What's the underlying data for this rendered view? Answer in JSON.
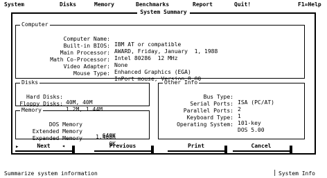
{
  "menu": {
    "system": "System",
    "disks": "Disks",
    "memory": "Memory",
    "benchmarks": "Benchmarks",
    "report": "Report",
    "quit": "Quit!",
    "help": "F1=Help"
  },
  "dialog": {
    "title": "System Summary"
  },
  "computer": {
    "title": "Computer",
    "rows": [
      {
        "label": "Computer Name:",
        "value": "IBM AT or compatible"
      },
      {
        "label": "Built-in BIOS:",
        "value": "AWARD, Friday, January  1, 1988"
      },
      {
        "label": "Main Processor:",
        "value": "Intel 80286  12 MHz"
      },
      {
        "label": "Math Co-Processor:",
        "value": "None"
      },
      {
        "label": "Video Adapter:",
        "value": "Enhanced Graphics (EGA)"
      },
      {
        "label": "Mouse Type:",
        "value": "InPort mouse, Version 8.00"
      }
    ]
  },
  "disks": {
    "title": "Disks",
    "rows": [
      {
        "label": "Hard Disks:",
        "value": "40M, 40M"
      },
      {
        "label": "Floppy Disks:",
        "value": "1.2M, 1.44M"
      }
    ]
  },
  "memory": {
    "title": "Memory",
    "rows": [
      {
        "label": "DOS Memory",
        "value": "640K"
      },
      {
        "label": "Extended Memory",
        "value": "1,408K"
      },
      {
        "label": "Expanded Memory",
        "value": "0K"
      }
    ]
  },
  "other": {
    "title": "Other Info",
    "rows": [
      {
        "label": "Bus Type:",
        "value": "ISA (PC/AT)"
      },
      {
        "label": "Serial Ports:",
        "value": "2"
      },
      {
        "label": "Parallel Ports:",
        "value": "1"
      },
      {
        "label": "Keyboard Type:",
        "value": "101-key"
      },
      {
        "label": "Operating System:",
        "value": "DOS 5.00"
      }
    ]
  },
  "buttons": {
    "next": "Next",
    "previous": "Previous",
    "print": "Print",
    "cancel": "Cancel"
  },
  "status": {
    "left": "Summarize system information",
    "right": "System Info"
  }
}
